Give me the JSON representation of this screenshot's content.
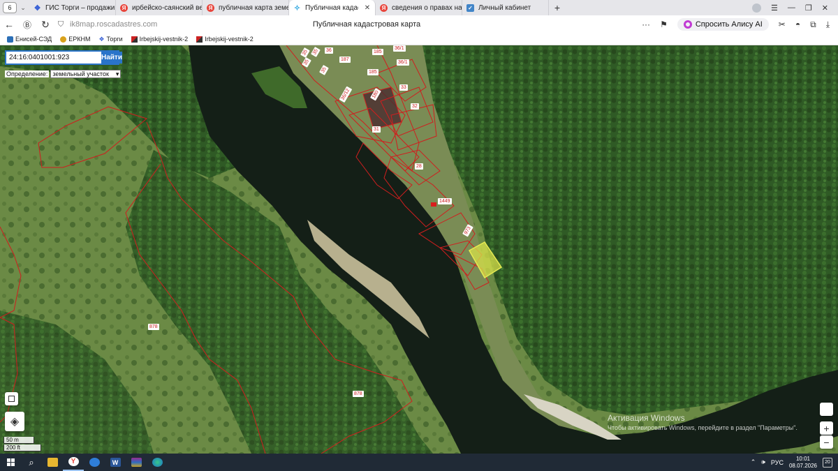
{
  "browser": {
    "tab_count": "6",
    "tabs": [
      {
        "title": "ГИС Торги – продажи гос",
        "icon": "gis-torgi-icon",
        "active": false
      },
      {
        "title": "ирбейско-саянский вест",
        "icon": "yandex-icon",
        "active": false
      },
      {
        "title": "публичная карта земель",
        "icon": "yandex-icon",
        "active": false
      },
      {
        "title": "Публичная кадастрова",
        "icon": "rosreestr-map-icon",
        "active": true
      },
      {
        "title": "сведения о правах на нед",
        "icon": "yandex-icon",
        "active": false
      },
      {
        "title": "Личный кабинет",
        "icon": "cabinet-icon",
        "active": false
      }
    ],
    "url": "ik8map.roscadastres.com",
    "page_title": "Публичная кадастровая карта",
    "alice_label": "Спросить Алису AI"
  },
  "bookmarks": [
    {
      "label": "Енисей-СЭД"
    },
    {
      "label": "ЕРКНМ"
    },
    {
      "label": "Торги"
    },
    {
      "label": "Irbejskij-vestnik-2"
    },
    {
      "label": "Irbejskij-vestnik-2"
    }
  ],
  "map": {
    "search_value": "24:16:0401001:923",
    "search_button": "Найти",
    "definition_label": "Определение:",
    "definition_value": "земельный участок",
    "parcel_labels": {
      "p35a": "35",
      "p35b": "35",
      "p36": "36",
      "p35c": "35",
      "p187": "187",
      "p185a": "185",
      "p3611a": "36/1",
      "p185b": "185",
      "p3611b": "36/1",
      "p35d": "35",
      "p3612": "36/12",
      "p180": "180",
      "p33": "33",
      "p32": "32",
      "p31": "31",
      "p28": "28",
      "p1449": "1449",
      "p973": "973",
      "p878a": "878",
      "p878b": "878"
    },
    "scale_m": "50 m",
    "scale_ft": "200 ft",
    "activation_title": "Активация Windows",
    "activation_sub": "Чтобы активировать Windows, перейдите в раздел \"Параметры\"."
  },
  "taskbar": {
    "language": "РУС",
    "time": "10:01",
    "date": "08.07.2026",
    "notifications": "20"
  }
}
